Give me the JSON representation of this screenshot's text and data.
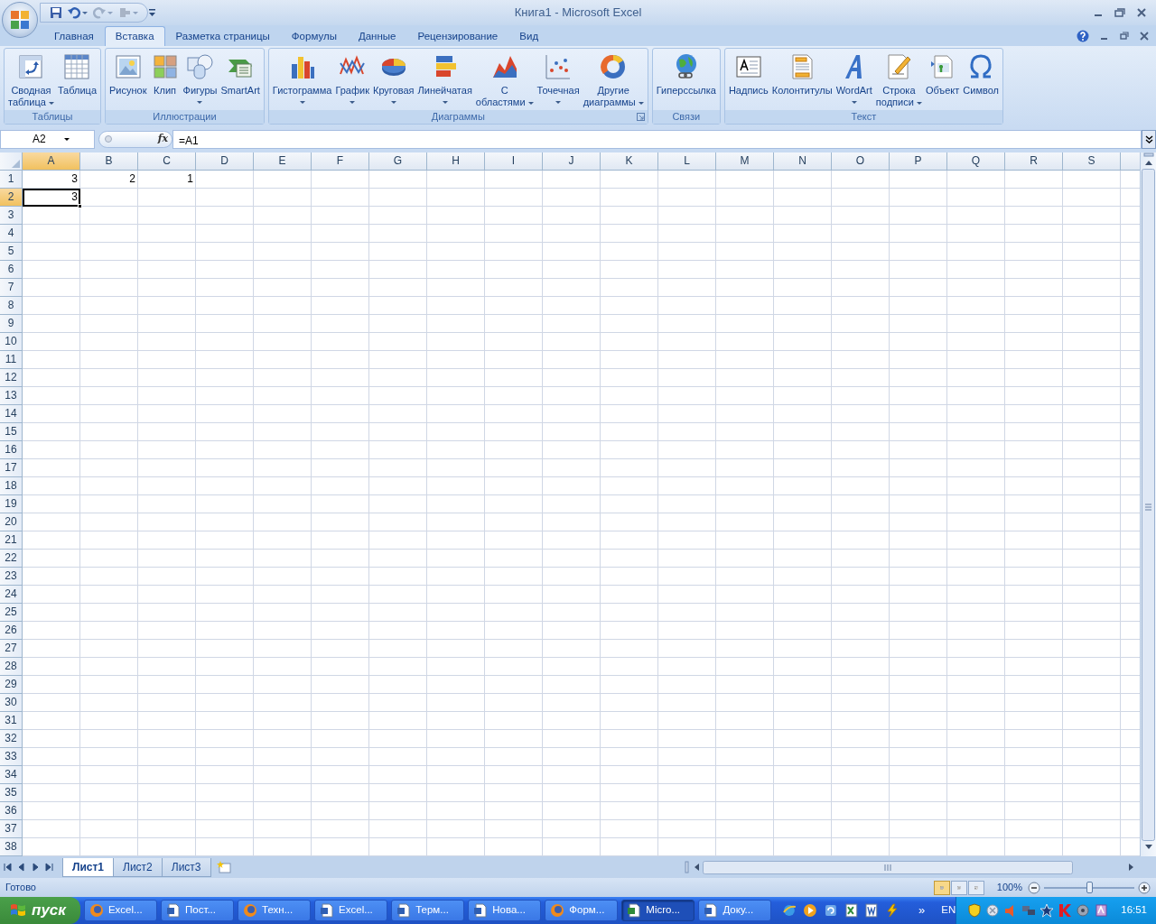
{
  "window": {
    "title": "Книга1 - Microsoft Excel"
  },
  "ribbon_tabs": [
    {
      "label": "Главная",
      "selected": false
    },
    {
      "label": "Вставка",
      "selected": true
    },
    {
      "label": "Разметка страницы",
      "selected": false
    },
    {
      "label": "Формулы",
      "selected": false
    },
    {
      "label": "Данные",
      "selected": false
    },
    {
      "label": "Рецензирование",
      "selected": false
    },
    {
      "label": "Вид",
      "selected": false
    }
  ],
  "ribbon_groups": [
    {
      "label": "Таблицы",
      "launcher": false,
      "buttons": [
        {
          "lines": [
            "Сводная",
            "таблица"
          ],
          "menu": true
        },
        {
          "lines": [
            "Таблица"
          ],
          "menu": false
        }
      ]
    },
    {
      "label": "Иллюстрации",
      "launcher": false,
      "buttons": [
        {
          "lines": [
            "Рисунок"
          ],
          "menu": false
        },
        {
          "lines": [
            "Клип"
          ],
          "menu": false
        },
        {
          "lines": [
            "Фигуры"
          ],
          "menu": true
        },
        {
          "lines": [
            "SmartArt"
          ],
          "menu": false
        }
      ]
    },
    {
      "label": "Диаграммы",
      "launcher": true,
      "buttons": [
        {
          "lines": [
            "Гистограмма"
          ],
          "menu": true
        },
        {
          "lines": [
            "График"
          ],
          "menu": true
        },
        {
          "lines": [
            "Круговая"
          ],
          "menu": true
        },
        {
          "lines": [
            "Линейчатая"
          ],
          "menu": true
        },
        {
          "lines": [
            "С",
            "областями"
          ],
          "menu": true
        },
        {
          "lines": [
            "Точечная"
          ],
          "menu": true
        },
        {
          "lines": [
            "Другие",
            "диаграммы"
          ],
          "menu": true
        }
      ]
    },
    {
      "label": "Связи",
      "launcher": false,
      "buttons": [
        {
          "lines": [
            "Гиперссылка"
          ],
          "menu": false
        }
      ]
    },
    {
      "label": "Текст",
      "launcher": false,
      "buttons": [
        {
          "lines": [
            "Надпись"
          ],
          "menu": false
        },
        {
          "lines": [
            "Колонтитулы"
          ],
          "menu": false
        },
        {
          "lines": [
            "WordArt"
          ],
          "menu": true
        },
        {
          "lines": [
            "Строка",
            "подписи"
          ],
          "menu": true
        },
        {
          "lines": [
            "Объект"
          ],
          "menu": false
        },
        {
          "lines": [
            "Символ"
          ],
          "menu": false
        }
      ]
    }
  ],
  "name_box": {
    "value": "A2"
  },
  "formula_bar": {
    "function_button": "fx",
    "value": "=A1"
  },
  "columns": [
    {
      "label": "A",
      "selected": true
    },
    {
      "label": "B",
      "selected": false
    },
    {
      "label": "C",
      "selected": false
    },
    {
      "label": "D",
      "selected": false
    },
    {
      "label": "E",
      "selected": false
    },
    {
      "label": "F",
      "selected": false
    },
    {
      "label": "G",
      "selected": false
    },
    {
      "label": "H",
      "selected": false
    },
    {
      "label": "I",
      "selected": false
    },
    {
      "label": "J",
      "selected": false
    },
    {
      "label": "K",
      "selected": false
    },
    {
      "label": "L",
      "selected": false
    },
    {
      "label": "M",
      "selected": false
    },
    {
      "label": "N",
      "selected": false
    },
    {
      "label": "O",
      "selected": false
    },
    {
      "label": "P",
      "selected": false
    },
    {
      "label": "Q",
      "selected": false
    },
    {
      "label": "R",
      "selected": false
    },
    {
      "label": "S",
      "selected": false
    }
  ],
  "rows": [
    {
      "label": "1",
      "selected": false,
      "cells": [
        "3",
        "2",
        "1"
      ]
    },
    {
      "label": "2",
      "selected": true,
      "cells": [
        "3"
      ]
    },
    {
      "label": "3",
      "selected": false
    },
    {
      "label": "4",
      "selected": false
    },
    {
      "label": "5",
      "selected": false
    },
    {
      "label": "6",
      "selected": false
    },
    {
      "label": "7",
      "selected": false
    },
    {
      "label": "8",
      "selected": false
    },
    {
      "label": "9",
      "selected": false
    },
    {
      "label": "10",
      "selected": false
    },
    {
      "label": "11",
      "selected": false
    },
    {
      "label": "12",
      "selected": false
    },
    {
      "label": "13",
      "selected": false
    },
    {
      "label": "14",
      "selected": false
    },
    {
      "label": "15",
      "selected": false
    },
    {
      "label": "16",
      "selected": false
    },
    {
      "label": "17",
      "selected": false
    },
    {
      "label": "18",
      "selected": false
    },
    {
      "label": "19",
      "selected": false
    },
    {
      "label": "20",
      "selected": false
    },
    {
      "label": "21",
      "selected": false
    },
    {
      "label": "22",
      "selected": false
    },
    {
      "label": "23",
      "selected": false
    },
    {
      "label": "24",
      "selected": false
    },
    {
      "label": "25",
      "selected": false
    },
    {
      "label": "26",
      "selected": false
    },
    {
      "label": "27",
      "selected": false
    },
    {
      "label": "28",
      "selected": false
    },
    {
      "label": "29",
      "selected": false
    },
    {
      "label": "30",
      "selected": false
    },
    {
      "label": "31",
      "selected": false
    },
    {
      "label": "32",
      "selected": false
    },
    {
      "label": "33",
      "selected": false
    },
    {
      "label": "34",
      "selected": false
    },
    {
      "label": "35",
      "selected": false
    },
    {
      "label": "36",
      "selected": false
    },
    {
      "label": "37",
      "selected": false
    },
    {
      "label": "38",
      "selected": false
    }
  ],
  "sheet_tabs": [
    {
      "label": "Лист1",
      "selected": true
    },
    {
      "label": "Лист2",
      "selected": false
    },
    {
      "label": "Лист3",
      "selected": false
    }
  ],
  "status_bar": {
    "text": "Готово",
    "view_buttons": [
      {
        "selected": true
      },
      {
        "selected": false
      },
      {
        "selected": false
      }
    ],
    "zoom": "100%",
    "zoom_slider": {
      "level": 0.5
    }
  },
  "taskbar": {
    "start": "пуск",
    "tasks": [
      {
        "label": "Excel...",
        "kind": "browser",
        "selected": false
      },
      {
        "label": "Пост...",
        "kind": "document",
        "selected": false
      },
      {
        "label": "Техн...",
        "kind": "browser",
        "selected": false
      },
      {
        "label": "Excel...",
        "kind": "document",
        "selected": false
      },
      {
        "label": "Терм...",
        "kind": "document",
        "selected": false
      },
      {
        "label": "Нова...",
        "kind": "document",
        "selected": false
      },
      {
        "label": "Форм...",
        "kind": "browser",
        "selected": false
      },
      {
        "label": "Micro...",
        "kind": "spreadsheet",
        "selected": true
      },
      {
        "label": "Доку...",
        "kind": "document",
        "selected": false
      }
    ],
    "chevron": "»",
    "language": "EN",
    "clock": "16:51"
  }
}
